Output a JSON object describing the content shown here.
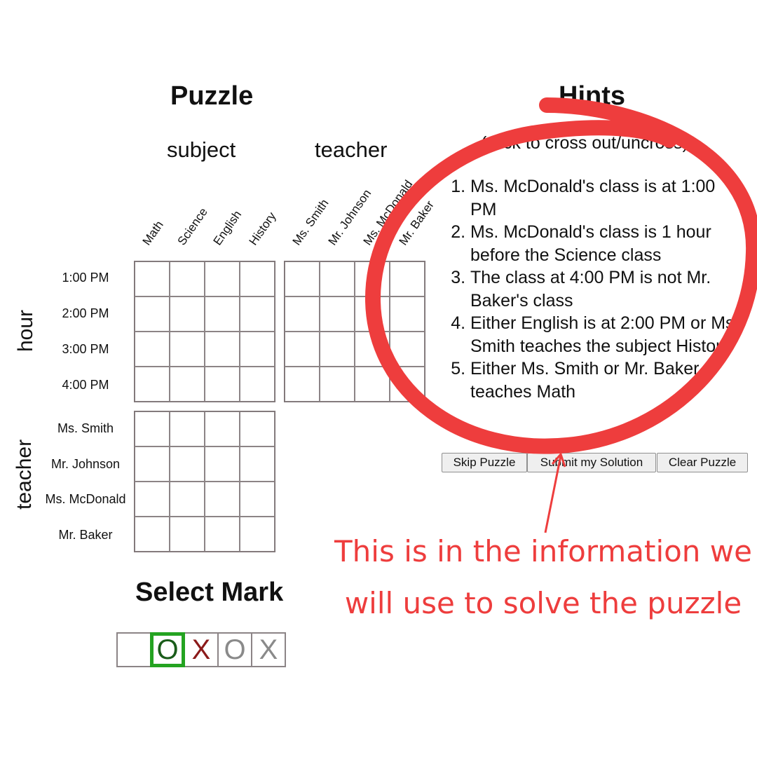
{
  "puzzle": {
    "title": "Puzzle",
    "col_categories": [
      "subject",
      "teacher"
    ],
    "row_categories": [
      "hour",
      "teacher"
    ],
    "subject_labels": [
      "Math",
      "Science",
      "English",
      "History"
    ],
    "teacher_col_labels": [
      "Ms. Smith",
      "Mr. Johnson",
      "Ms. McDonald",
      "Mr. Baker"
    ],
    "hour_labels": [
      "1:00 PM",
      "2:00 PM",
      "3:00 PM",
      "4:00 PM"
    ],
    "teacher_row_labels": [
      "Ms. Smith",
      "Mr. Johnson",
      "Ms. McDonald",
      "Mr. Baker"
    ]
  },
  "hints": {
    "title": "Hints",
    "subtitle": "(click to cross out/uncross)",
    "items": [
      "Ms. McDonald's class is at 1:00 PM",
      "Ms. McDonald's class is 1 hour before the Science class",
      "The class at 4:00 PM is not Mr. Baker's class",
      "Either English is at 2:00 PM or Ms. Smith teaches the subject History",
      "Either Ms. Smith or Mr. Baker teaches Math"
    ]
  },
  "buttons": {
    "skip": "Skip Puzzle",
    "submit": "Submit my Solution",
    "clear": "Clear Puzzle"
  },
  "select_mark": {
    "title": "Select Mark",
    "marks": [
      {
        "label": "",
        "color": "#111111",
        "selected": false
      },
      {
        "label": "O",
        "color": "#1a5c1a",
        "selected": true
      },
      {
        "label": "X",
        "color": "#8b1a1a",
        "selected": false
      },
      {
        "label": "O",
        "color": "#8a8a8a",
        "selected": false
      },
      {
        "label": "X",
        "color": "#8a8a8a",
        "selected": false
      }
    ]
  },
  "annotation": {
    "line1": "This is in the information we",
    "line2": "will use to solve the puzzle",
    "color": "#ee3d3d"
  }
}
